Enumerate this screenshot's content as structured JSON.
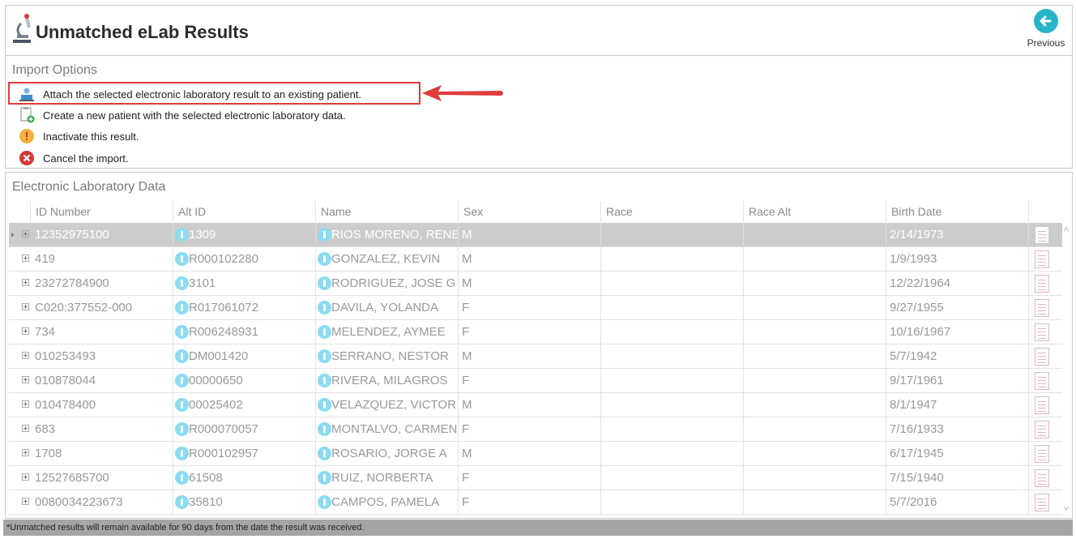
{
  "header": {
    "title": "Unmatched eLab Results",
    "previous_label": "Previous"
  },
  "import_options": {
    "title": "Import Options",
    "options": [
      {
        "label": "Attach the selected electronic laboratory result to an existing patient.",
        "icon": "patient-attach-icon"
      },
      {
        "label": "Create a new patient with the selected electronic laboratory data.",
        "icon": "new-patient-icon"
      },
      {
        "label": "Inactivate this result.",
        "icon": "warning-icon"
      },
      {
        "label": "Cancel the import.",
        "icon": "cancel-icon"
      }
    ]
  },
  "lab_data": {
    "title": "Electronic Laboratory Data",
    "columns": [
      "ID Number",
      "Alt ID",
      "Name",
      "Sex",
      "Race",
      "Race Alt",
      "Birth Date"
    ],
    "rows": [
      {
        "id": "12352975100",
        "alt": "1309",
        "name": "RIOS MORENO, RENE",
        "sex": "M",
        "race": "",
        "race_alt": "",
        "dob": "2/14/1973",
        "selected": true
      },
      {
        "id": "419",
        "alt": "R000102280",
        "name": "GONZALEZ, KEVIN",
        "sex": "M",
        "race": "",
        "race_alt": "",
        "dob": "1/9/1993"
      },
      {
        "id": "23272784900",
        "alt": "3101",
        "name": "RODRIGUEZ, JOSE G",
        "sex": "M",
        "race": "",
        "race_alt": "",
        "dob": "12/22/1964"
      },
      {
        "id": "C020:377552-000",
        "alt": "R017061072",
        "name": "DAVILA, YOLANDA",
        "sex": "F",
        "race": "",
        "race_alt": "",
        "dob": "9/27/1955"
      },
      {
        "id": "734",
        "alt": "R006248931",
        "name": "MELENDEZ, AYMEE",
        "sex": "F",
        "race": "",
        "race_alt": "",
        "dob": "10/16/1967"
      },
      {
        "id": "010253493",
        "alt": "DM001420",
        "name": "SERRANO, NESTOR",
        "sex": "M",
        "race": "",
        "race_alt": "",
        "dob": "5/7/1942"
      },
      {
        "id": "010878044",
        "alt": "00000650",
        "name": "RIVERA, MILAGROS",
        "sex": "F",
        "race": "",
        "race_alt": "",
        "dob": "9/17/1961"
      },
      {
        "id": "010478400",
        "alt": "00025402",
        "name": "VELAZQUEZ, VICTOR I",
        "sex": "M",
        "race": "",
        "race_alt": "",
        "dob": "8/1/1947"
      },
      {
        "id": "683",
        "alt": "R000070057",
        "name": "MONTALVO, CARMEN",
        "sex": "F",
        "race": "",
        "race_alt": "",
        "dob": "7/16/1933"
      },
      {
        "id": "1708",
        "alt": "R000102957",
        "name": "ROSARIO, JORGE A",
        "sex": "M",
        "race": "",
        "race_alt": "",
        "dob": "6/17/1945"
      },
      {
        "id": "12527685700",
        "alt": "61508",
        "name": "RUIZ, NORBERTA",
        "sex": "F",
        "race": "",
        "race_alt": "",
        "dob": "7/15/1940"
      },
      {
        "id": "0080034223673",
        "alt": "35810",
        "name": "CAMPOS, PAMELA",
        "sex": "F",
        "race": "",
        "race_alt": "",
        "dob": "5/7/2016"
      }
    ]
  },
  "footer": {
    "note": "*Unmatched results will remain available for 90 days from the date the result was received."
  },
  "colors": {
    "accent": "#28b4c8",
    "highlight": "#e03c3c",
    "info": "#8bdcf3",
    "selected_row": "#cccccc"
  }
}
